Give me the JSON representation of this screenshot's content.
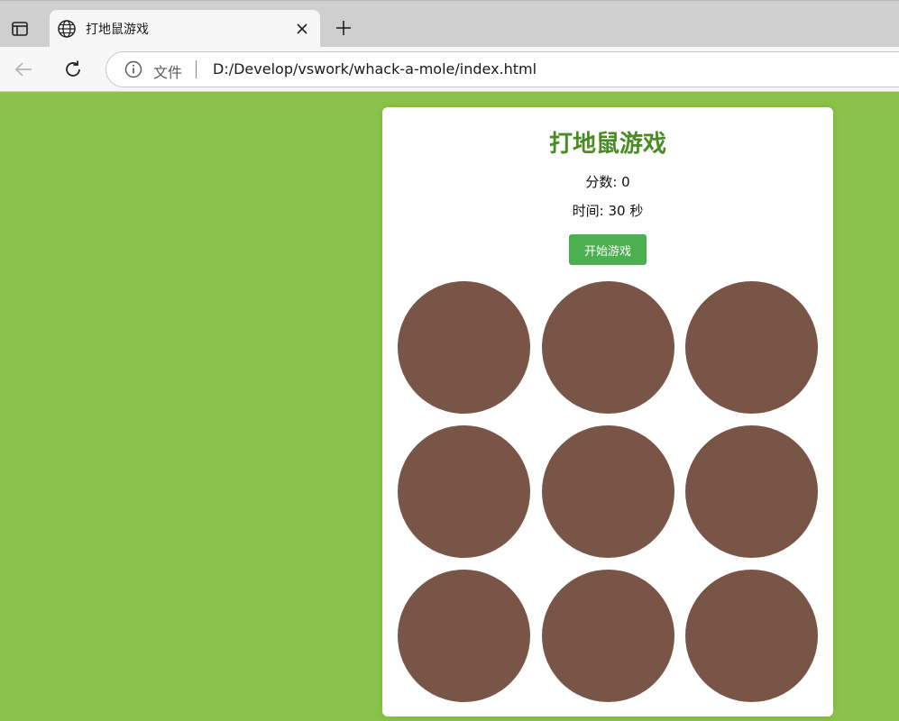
{
  "browser": {
    "tab": {
      "title": "打地鼠游戏"
    },
    "address": {
      "site_label": "文件",
      "url": "D:/Develop/vswork/whack-a-mole/index.html"
    }
  },
  "icons": {
    "tab_actions": "tab-actions-icon",
    "favicon": "globe-icon",
    "close": "close-icon",
    "new_tab": "plus-icon",
    "back": "back-arrow-icon",
    "reload": "reload-icon",
    "info": "info-icon"
  },
  "colors": {
    "page_background": "#8bc34a",
    "title": "#4b8b26",
    "start_button": "#4caf50",
    "hole": "#795548"
  },
  "game": {
    "title": "打地鼠游戏",
    "score_text": "分数: 0",
    "time_text": "时间: 30 秒",
    "start_label": "开始游戏",
    "holes": 9
  }
}
